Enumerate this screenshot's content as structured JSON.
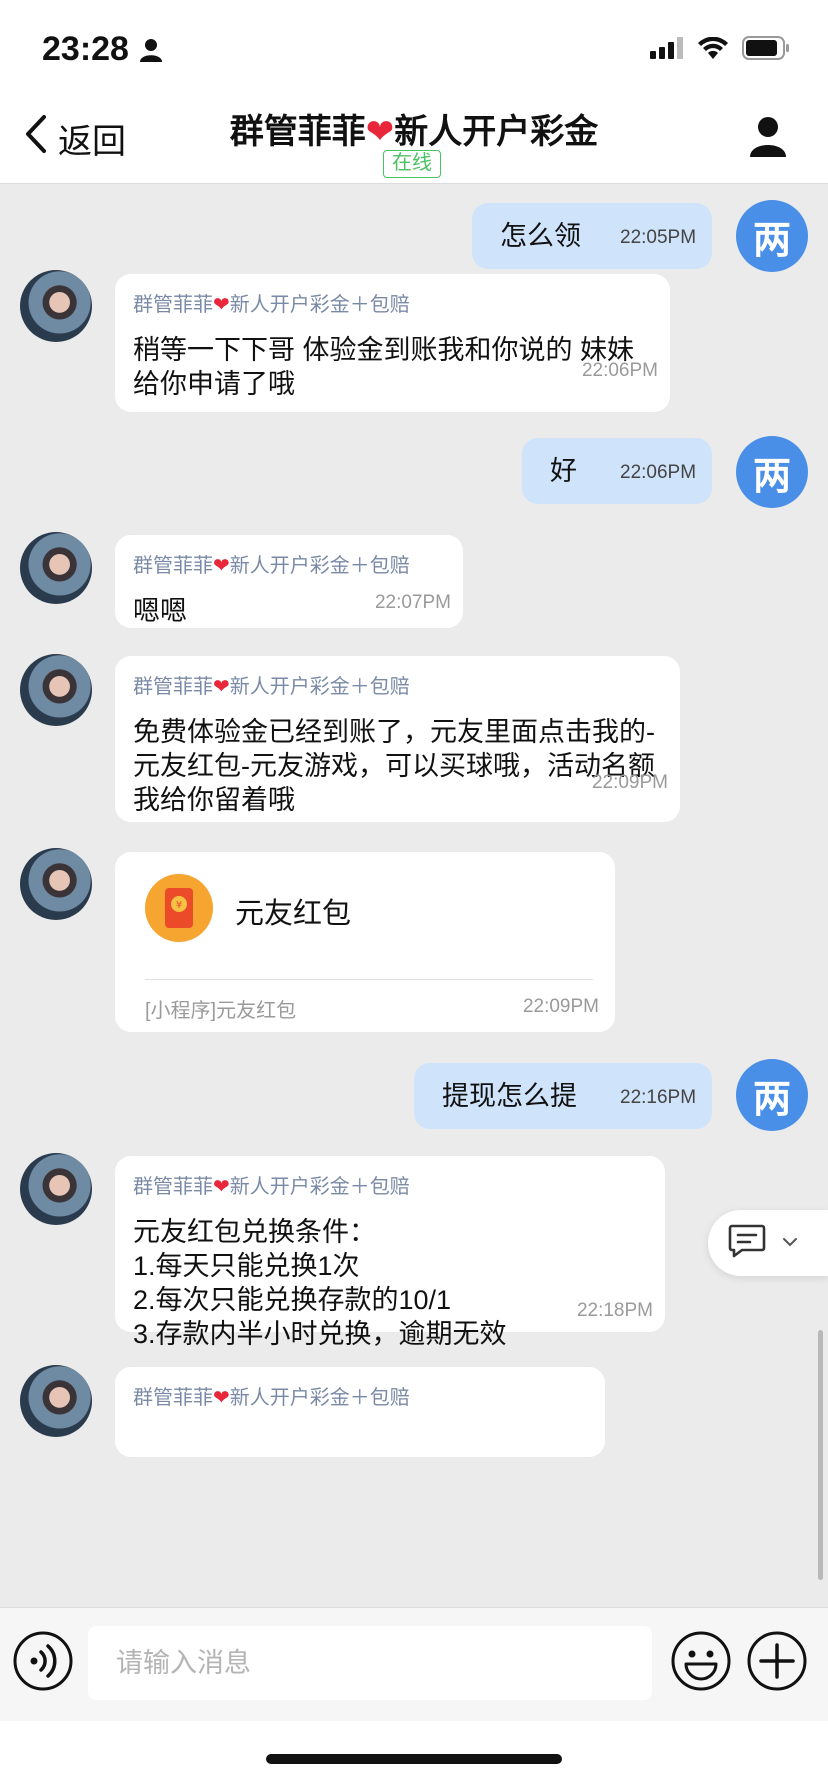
{
  "status": {
    "time": "23:28"
  },
  "nav": {
    "back_label": "返回",
    "title_before": "群管菲菲",
    "title_after": "新人开户彩金",
    "heart": "❤",
    "online": "在线"
  },
  "sender": {
    "name_before": "群管菲菲",
    "name_after": "新人开户彩金＋包赔",
    "heart": "❤"
  },
  "me_avatar": "两",
  "messages": [
    {
      "from": "me",
      "text": "怎么领",
      "time": "22:05PM"
    },
    {
      "from": "other",
      "text": "稍等一下下哥 体验金到账我和你说的 妹妹给你申请了哦",
      "time": "22:06PM"
    },
    {
      "from": "me",
      "text": "好",
      "time": "22:06PM"
    },
    {
      "from": "other",
      "text": "嗯嗯",
      "time": "22:07PM"
    },
    {
      "from": "other",
      "text": "免费体验金已经到账了，元友里面点击我的-元友红包-元友游戏，可以买球哦，活动名额我给你留着哦",
      "time": "22:09PM"
    },
    {
      "from": "other",
      "card_title": "元友红包",
      "card_footer": "[小程序]元友红包",
      "time": "22:09PM"
    },
    {
      "from": "me",
      "text": "提现怎么提",
      "time": "22:16PM"
    },
    {
      "from": "other",
      "lines": [
        "元友红包兑换条件：",
        "1.每天只能兑换1次",
        "2.每次只能兑换存款的10/1",
        "3.存款内半小时兑换，逾期无效"
      ],
      "time": "22:18PM"
    }
  ],
  "input": {
    "placeholder": "请输入消息"
  },
  "colors": {
    "me_bubble": "#cfe3fb",
    "me_avatar": "#4a8fe7",
    "online": "#4cc162",
    "heart": "#e8283a"
  }
}
